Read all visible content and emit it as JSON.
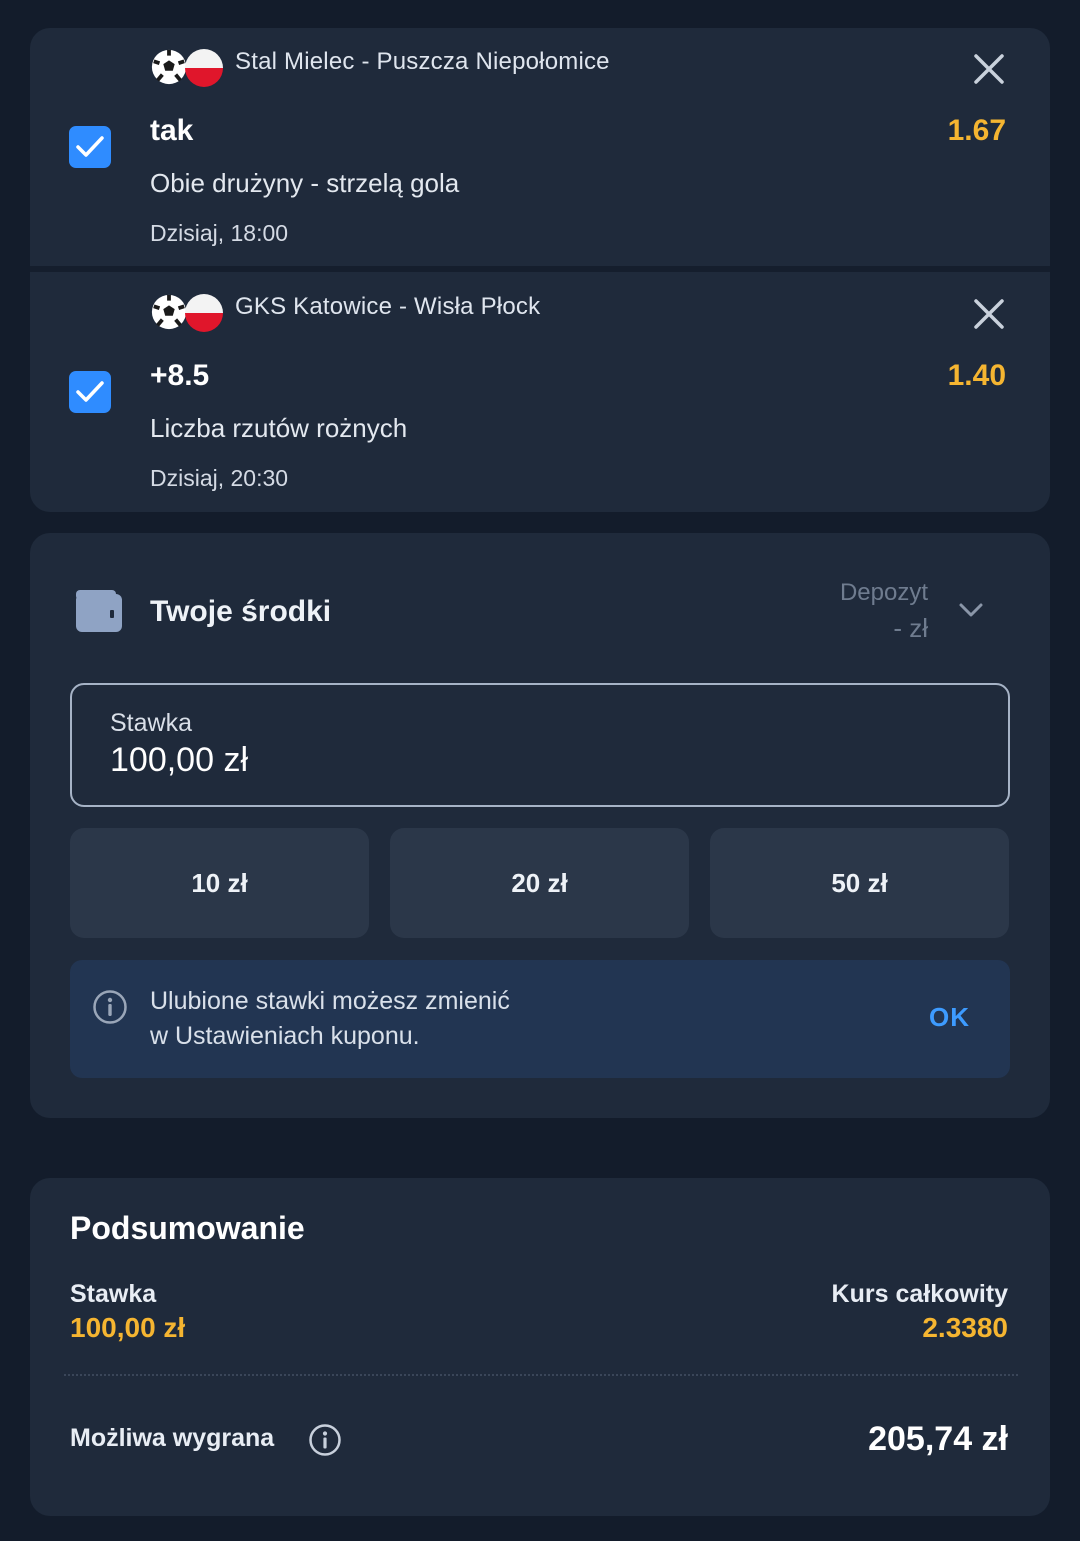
{
  "bets": [
    {
      "match": "Stal Mielec - Puszcza Niepołomice",
      "pick": "tak",
      "odds": "1.67",
      "market": "Obie drużyny - strzelą gola",
      "time": "Dzisiaj, 18:00",
      "checked": true
    },
    {
      "match": "GKS Katowice - Wisła Płock",
      "pick": "+8.5",
      "odds": "1.40",
      "market": "Liczba rzutów rożnych",
      "time": "Dzisiaj, 20:30",
      "checked": true
    }
  ],
  "funds": {
    "title": "Twoje środki",
    "deposit_label": "Depozyt",
    "deposit_value": "- zł",
    "stake_label": "Stawka",
    "stake_value": "100,00 zł",
    "quick_stakes": [
      "10 zł",
      "20 zł",
      "50 zł"
    ],
    "info_line1": "Ulubione stawki możesz zmienić",
    "info_line2": "w Ustawieniach kuponu.",
    "ok_label": "OK"
  },
  "summary": {
    "title": "Podsumowanie",
    "stake_label": "Stawka",
    "stake_value": "100,00 zł",
    "odds_label": "Kurs całkowity",
    "odds_value": "2.3380",
    "win_label": "Możliwa wygrana",
    "win_value": "205,74 zł"
  },
  "colors": {
    "background": "#131c2b",
    "card": "#1f2a3b",
    "accent_odds": "#f5b531",
    "checkbox": "#2f8cff",
    "ok_link": "#3d9bff"
  },
  "icons": [
    "soccer-ball-icon",
    "poland-flag-icon",
    "close-icon",
    "checkmark-icon",
    "wallet-icon",
    "chevron-down-icon",
    "info-icon"
  ]
}
